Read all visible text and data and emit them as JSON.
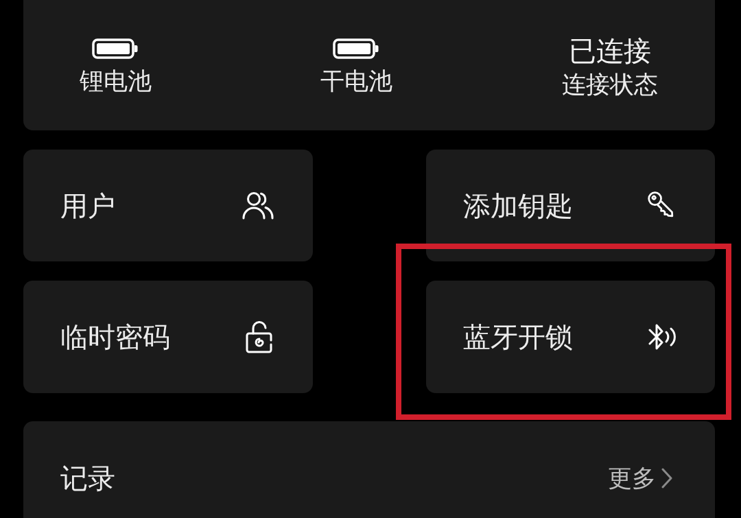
{
  "status_panel": {
    "items": [
      {
        "kind": "battery",
        "label": "锂电池"
      },
      {
        "kind": "battery",
        "label": "干电池"
      },
      {
        "kind": "connection",
        "value": "已连接",
        "label": "连接状态"
      }
    ]
  },
  "tiles": [
    {
      "label": "用户",
      "highlighted": false
    },
    {
      "label": "添加钥匙",
      "highlighted": false
    },
    {
      "label": "临时密码",
      "highlighted": false
    },
    {
      "label": "蓝牙开锁",
      "highlighted": true
    }
  ],
  "records": {
    "title": "记录",
    "more": "更多"
  }
}
